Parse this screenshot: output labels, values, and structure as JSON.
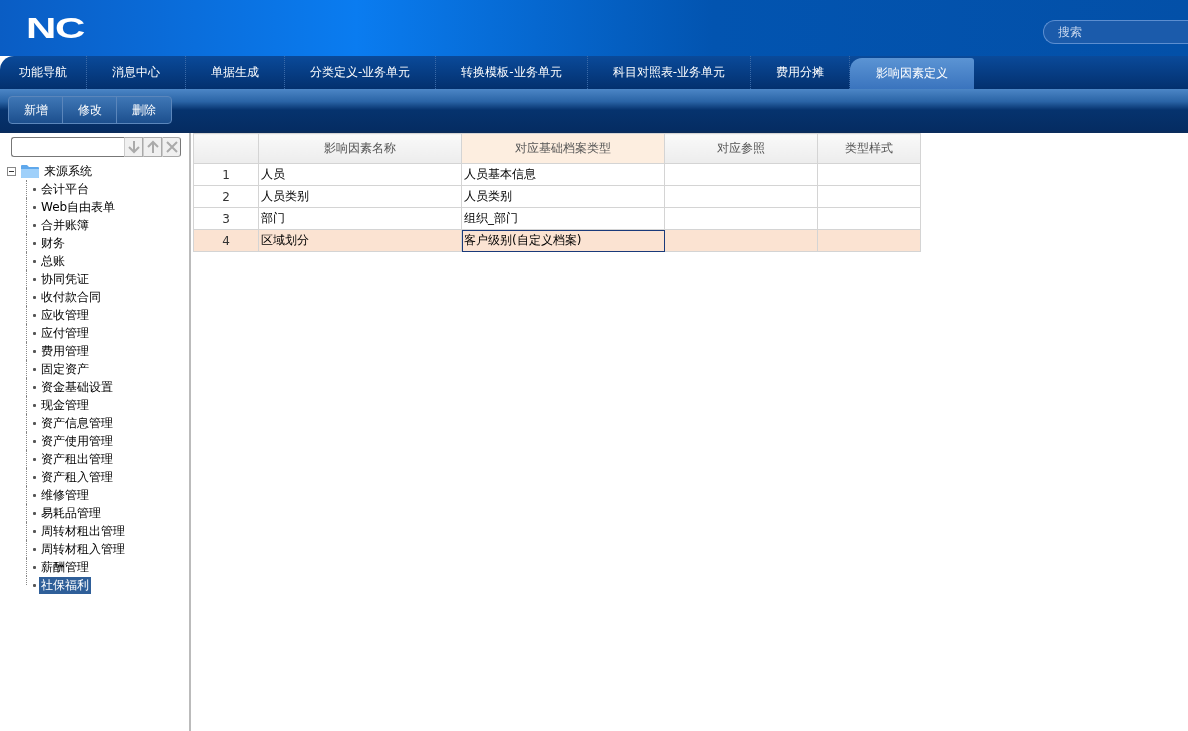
{
  "header": {
    "logo": "NC",
    "search": {
      "placeholder": "搜索"
    }
  },
  "tabs": [
    {
      "label": "功能导航",
      "selected": false
    },
    {
      "label": "消息中心",
      "selected": false
    },
    {
      "label": "单据生成",
      "selected": false
    },
    {
      "label": "分类定义-业务单元",
      "selected": false
    },
    {
      "label": "转换模板-业务单元",
      "selected": false
    },
    {
      "label": "科目对照表-业务单元",
      "selected": false
    },
    {
      "label": "费用分摊",
      "selected": false
    },
    {
      "label": "影响因素定义",
      "selected": true
    }
  ],
  "toolbar": [
    "新增",
    "修改",
    "删除"
  ],
  "tree": {
    "items": [
      {
        "label": "来源系统",
        "expanded": true,
        "selected": false,
        "children": [
          {
            "label": "会计平台",
            "selected": false
          },
          {
            "label": "Web自由表单",
            "selected": false
          },
          {
            "label": "合并账簿",
            "selected": false
          },
          {
            "label": "财务",
            "selected": false
          },
          {
            "label": "总账",
            "selected": false
          },
          {
            "label": "协同凭证",
            "selected": false
          },
          {
            "label": "收付款合同",
            "selected": false
          },
          {
            "label": "应收管理",
            "selected": false
          },
          {
            "label": "应付管理",
            "selected": false
          },
          {
            "label": "费用管理",
            "selected": false
          },
          {
            "label": "固定资产",
            "selected": false
          },
          {
            "label": "资金基础设置",
            "selected": false
          },
          {
            "label": "现金管理",
            "selected": false
          },
          {
            "label": "资产信息管理",
            "selected": false
          },
          {
            "label": "资产使用管理",
            "selected": false
          },
          {
            "label": "资产租出管理",
            "selected": false
          },
          {
            "label": "资产租入管理",
            "selected": false
          },
          {
            "label": "维修管理",
            "selected": false
          },
          {
            "label": "易耗品管理",
            "selected": false
          },
          {
            "label": "周转材租出管理",
            "selected": false
          },
          {
            "label": "周转材租入管理",
            "selected": false
          },
          {
            "label": "薪酬管理",
            "selected": false
          },
          {
            "label": "社保福利",
            "selected": true
          }
        ]
      }
    ]
  },
  "table": {
    "columns": [
      {
        "label": "影响因素名称",
        "selected": false
      },
      {
        "label": "对应基础档案类型",
        "selected": true
      },
      {
        "label": "对应参照",
        "selected": false
      },
      {
        "label": "类型样式",
        "selected": false
      }
    ],
    "rows": [
      {
        "number": "1",
        "cells": [
          "人员",
          "人员基本信息",
          "",
          ""
        ],
        "selected": false
      },
      {
        "number": "2",
        "cells": [
          "人员类别",
          "人员类别",
          "",
          ""
        ],
        "selected": false
      },
      {
        "number": "3",
        "cells": [
          "部门",
          "组织_部门",
          "",
          ""
        ],
        "selected": false
      },
      {
        "number": "4",
        "cells": [
          "区域划分",
          "客户级别(自定义档案)",
          "",
          ""
        ],
        "selected": true
      }
    ]
  }
}
